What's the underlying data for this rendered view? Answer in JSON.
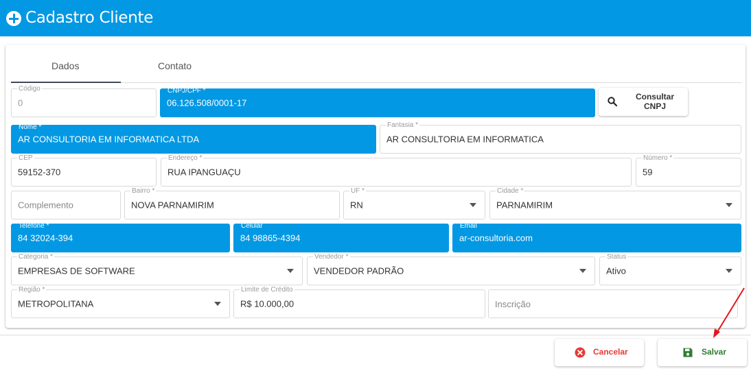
{
  "header": {
    "title": "Cadastro Cliente"
  },
  "tabs": [
    {
      "label": "Dados"
    },
    {
      "label": "Contato"
    }
  ],
  "fields": {
    "codigo": {
      "label": "Código",
      "value": "0"
    },
    "cnpj": {
      "label": "CNPJ/CPF *",
      "value": "06.126.508/0001-17"
    },
    "nome": {
      "label": "Nome *",
      "value": "AR CONSULTORIA EM INFORMATICA LTDA"
    },
    "fantasia": {
      "label": "Fantasia *",
      "value": "AR CONSULTORIA EM INFORMATICA"
    },
    "cep": {
      "label": "CEP",
      "value": "59152-370"
    },
    "endereco": {
      "label": "Endereço *",
      "value": "RUA IPANGUAÇU"
    },
    "numero": {
      "label": "Número *",
      "value": "59"
    },
    "complemento": {
      "placeholder": "Complemento"
    },
    "bairro": {
      "label": "Bairro *",
      "value": "NOVA PARNAMIRIM"
    },
    "uf": {
      "label": "UF *",
      "value": "RN"
    },
    "cidade": {
      "label": "Cidade *",
      "value": "PARNAMIRIM"
    },
    "telefone": {
      "label": "Telefone *",
      "value": "84 32024-394"
    },
    "celular": {
      "label": "Celular",
      "value": "84 98865-4394"
    },
    "email": {
      "label": "Email",
      "value": "ar-consultoria.com"
    },
    "categoria": {
      "label": "Categoria *",
      "value": "EMPRESAS DE SOFTWARE"
    },
    "vendedor": {
      "label": "Vendedor *",
      "value": "VENDEDOR PADRÃO"
    },
    "status": {
      "label": "Status",
      "value": "Ativo"
    },
    "regiao": {
      "label": "Região *",
      "value": "METROPOLITANA"
    },
    "limite": {
      "label": "Limite de Crédito",
      "value": "R$ 10.000,00"
    },
    "inscricao": {
      "placeholder": "Inscrição"
    }
  },
  "buttons": {
    "consultar": "Consultar CNPJ",
    "cancelar": "Cancelar",
    "salvar": "Salvar"
  },
  "icons": {
    "header": "plus-circle-icon",
    "consultar": "search-icon",
    "cancelar": "close-circle-icon",
    "salvar": "floppy-disk-icon"
  },
  "colors": {
    "primary": "#0398e3",
    "danger": "#e53935",
    "success": "#2e7d32",
    "annotation": "#e3161b"
  }
}
